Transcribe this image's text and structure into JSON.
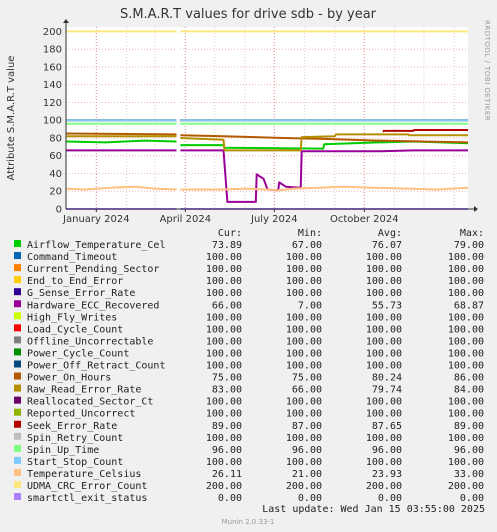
{
  "chart_data": {
    "type": "line",
    "title": "S.M.A.R.T values for drive sdb - by year",
    "ylabel": "Attribute S.M.A.R.T value",
    "ylim": [
      0,
      205
    ],
    "yticks": [
      0,
      20,
      40,
      60,
      80,
      100,
      120,
      140,
      160,
      180,
      200
    ],
    "xlim": [
      "2023-12-01",
      "2025-01-15"
    ],
    "xticks": [
      {
        "label": "January 2024",
        "date": "2024-01-01"
      },
      {
        "label": "April 2024",
        "date": "2024-04-01"
      },
      {
        "label": "July 2024",
        "date": "2024-07-01"
      },
      {
        "label": "October 2024",
        "date": "2024-10-01"
      }
    ],
    "gap": [
      "2024-03-23",
      "2024-03-27"
    ],
    "grid": true,
    "watermark": "RRDTOOL / TOBI OETIKER",
    "columns": [
      "Cur:",
      "Min:",
      "Avg:",
      "Max:"
    ],
    "series": [
      {
        "name": "Airflow_Temperature_Cel",
        "color": "#00cc00",
        "stats": [
          "73.89",
          "67.00",
          "76.07",
          "79.00"
        ],
        "points": [
          [
            "2023-12-01",
            76
          ],
          [
            "2024-01-10",
            75
          ],
          [
            "2024-02-20",
            77
          ],
          [
            "2024-03-23",
            76
          ],
          [
            "2024-03-27",
            72
          ],
          [
            "2024-05-10",
            72
          ],
          [
            "2024-05-11",
            69
          ],
          [
            "2024-08-20",
            68
          ],
          [
            "2024-08-21",
            73
          ],
          [
            "2024-10-15",
            75
          ],
          [
            "2024-11-20",
            76
          ],
          [
            "2025-01-15",
            74
          ]
        ]
      },
      {
        "name": "Command_Timeout",
        "color": "#0066b3",
        "stats": [
          "100.00",
          "100.00",
          "100.00",
          "100.00"
        ],
        "points": [
          [
            "2023-12-01",
            100
          ],
          [
            "2025-01-15",
            100
          ]
        ]
      },
      {
        "name": "Current_Pending_Sector",
        "color": "#ff8000",
        "stats": [
          "100.00",
          "100.00",
          "100.00",
          "100.00"
        ],
        "points": [
          [
            "2023-12-01",
            100
          ],
          [
            "2025-01-15",
            100
          ]
        ]
      },
      {
        "name": "End_to_End_Error",
        "color": "#ffcc00",
        "stats": [
          "100.00",
          "100.00",
          "100.00",
          "100.00"
        ],
        "points": [
          [
            "2023-12-01",
            100
          ],
          [
            "2025-01-15",
            100
          ]
        ]
      },
      {
        "name": "G_Sense_Error_Rate",
        "color": "#330099",
        "stats": [
          "100.00",
          "100.00",
          "100.00",
          "100.00"
        ],
        "points": [
          [
            "2023-12-01",
            100
          ],
          [
            "2025-01-15",
            100
          ]
        ]
      },
      {
        "name": "Hardware_ECC_Recovered",
        "color": "#990099",
        "stats": [
          "66.00",
          "7.00",
          "55.73",
          "68.87"
        ],
        "points": [
          [
            "2023-12-01",
            66
          ],
          [
            "2024-03-23",
            66
          ],
          [
            "2024-03-27",
            66
          ],
          [
            "2024-05-10",
            66
          ],
          [
            "2024-05-14",
            8
          ],
          [
            "2024-06-12",
            8
          ],
          [
            "2024-06-13",
            39
          ],
          [
            "2024-06-20",
            34
          ],
          [
            "2024-06-24",
            22
          ],
          [
            "2024-07-05",
            21
          ],
          [
            "2024-07-06",
            30
          ],
          [
            "2024-07-13",
            25
          ],
          [
            "2024-07-28",
            24
          ],
          [
            "2024-07-29",
            65
          ],
          [
            "2024-10-15",
            65
          ],
          [
            "2024-11-20",
            66
          ],
          [
            "2025-01-15",
            66
          ]
        ]
      },
      {
        "name": "High_Fly_Writes",
        "color": "#ccff00",
        "stats": [
          "100.00",
          "100.00",
          "100.00",
          "100.00"
        ],
        "points": [
          [
            "2023-12-01",
            100
          ],
          [
            "2025-01-15",
            100
          ]
        ]
      },
      {
        "name": "Load_Cycle_Count",
        "color": "#ff0000",
        "stats": [
          "100.00",
          "100.00",
          "100.00",
          "100.00"
        ],
        "points": [
          [
            "2023-12-01",
            100
          ],
          [
            "2025-01-15",
            100
          ]
        ]
      },
      {
        "name": "Offline_Uncorrectable",
        "color": "#808080",
        "stats": [
          "100.00",
          "100.00",
          "100.00",
          "100.00"
        ],
        "points": [
          [
            "2023-12-01",
            100
          ],
          [
            "2025-01-15",
            100
          ]
        ]
      },
      {
        "name": "Power_Cycle_Count",
        "color": "#008f00",
        "stats": [
          "100.00",
          "100.00",
          "100.00",
          "100.00"
        ],
        "points": [
          [
            "2023-12-01",
            100
          ],
          [
            "2025-01-15",
            100
          ]
        ]
      },
      {
        "name": "Power_Off_Retract_Count",
        "color": "#00487d",
        "stats": [
          "100.00",
          "100.00",
          "100.00",
          "100.00"
        ],
        "points": [
          [
            "2023-12-01",
            100
          ],
          [
            "2025-01-15",
            100
          ]
        ]
      },
      {
        "name": "Power_On_Hours",
        "color": "#b35a00",
        "stats": [
          "75.00",
          "75.00",
          "80.24",
          "86.00"
        ],
        "points": [
          [
            "2023-12-01",
            85
          ],
          [
            "2024-03-23",
            84
          ],
          [
            "2024-03-27",
            83
          ],
          [
            "2024-05-10",
            82
          ],
          [
            "2024-07-10",
            80
          ],
          [
            "2024-08-20",
            79
          ],
          [
            "2024-10-15",
            77
          ],
          [
            "2024-12-01",
            76
          ],
          [
            "2025-01-15",
            75
          ]
        ]
      },
      {
        "name": "Raw_Read_Error_Rate",
        "color": "#b38f00",
        "stats": [
          "83.00",
          "66.00",
          "79.74",
          "84.00"
        ],
        "points": [
          [
            "2023-12-01",
            82
          ],
          [
            "2024-03-23",
            82
          ],
          [
            "2024-03-27",
            80
          ],
          [
            "2024-05-10",
            78
          ],
          [
            "2024-05-11",
            66
          ],
          [
            "2024-07-28",
            66
          ],
          [
            "2024-07-29",
            81
          ],
          [
            "2024-09-01",
            82
          ],
          [
            "2024-09-02",
            84
          ],
          [
            "2024-11-15",
            84
          ],
          [
            "2024-11-16",
            83
          ],
          [
            "2025-01-15",
            83
          ]
        ]
      },
      {
        "name": "Reallocated_Sector_Ct",
        "color": "#6b006b",
        "stats": [
          "100.00",
          "100.00",
          "100.00",
          "100.00"
        ],
        "points": [
          [
            "2023-12-01",
            100
          ],
          [
            "2025-01-15",
            100
          ]
        ]
      },
      {
        "name": "Reported_Uncorrect",
        "color": "#8fb300",
        "stats": [
          "100.00",
          "100.00",
          "100.00",
          "100.00"
        ],
        "points": [
          [
            "2023-12-01",
            100
          ],
          [
            "2025-01-15",
            100
          ]
        ]
      },
      {
        "name": "Seek_Error_Rate",
        "color": "#b30000",
        "stats": [
          "89.00",
          "87.00",
          "87.65",
          "89.00"
        ],
        "points": [
          [
            "2023-12-01",
            87
          ],
          [
            "2024-10-20",
            87
          ],
          [
            "2024-10-21",
            88
          ],
          [
            "2024-11-20",
            88
          ],
          [
            "2024-11-21",
            89
          ],
          [
            "2025-01-15",
            89
          ]
        ]
      },
      {
        "name": "Spin_Retry_Count",
        "color": "#bebebe",
        "stats": [
          "100.00",
          "100.00",
          "100.00",
          "100.00"
        ],
        "points": [
          [
            "2023-12-01",
            100
          ],
          [
            "2025-01-15",
            100
          ]
        ]
      },
      {
        "name": "Spin_Up_Time",
        "color": "#80ff80",
        "stats": [
          "96.00",
          "96.00",
          "96.00",
          "96.00"
        ],
        "points": [
          [
            "2023-12-01",
            96
          ],
          [
            "2025-01-15",
            96
          ]
        ]
      },
      {
        "name": "Start_Stop_Count",
        "color": "#80c9ff",
        "stats": [
          "100.00",
          "100.00",
          "100.00",
          "100.00"
        ],
        "points": [
          [
            "2023-12-01",
            100
          ],
          [
            "2025-01-15",
            100
          ]
        ]
      },
      {
        "name": "Temperature_Celsius",
        "color": "#ffc080",
        "stats": [
          "26.11",
          "21.00",
          "23.93",
          "33.00"
        ],
        "points": [
          [
            "2023-12-01",
            23
          ],
          [
            "2023-12-20",
            22
          ],
          [
            "2024-01-15",
            24
          ],
          [
            "2024-02-10",
            25
          ],
          [
            "2024-03-01",
            23
          ],
          [
            "2024-03-23",
            22
          ],
          [
            "2024-03-27",
            22
          ],
          [
            "2024-05-10",
            22
          ],
          [
            "2024-06-01",
            23
          ],
          [
            "2024-06-24",
            22
          ],
          [
            "2024-07-05",
            21
          ],
          [
            "2024-07-20",
            23
          ],
          [
            "2024-08-15",
            24
          ],
          [
            "2024-09-10",
            25
          ],
          [
            "2024-10-10",
            24
          ],
          [
            "2024-11-15",
            23
          ],
          [
            "2024-12-15",
            22
          ],
          [
            "2025-01-15",
            24
          ]
        ]
      },
      {
        "name": "UDMA_CRC_Error_Count",
        "color": "#ffe680",
        "stats": [
          "200.00",
          "200.00",
          "200.00",
          "200.00"
        ],
        "points": [
          [
            "2023-12-01",
            200
          ],
          [
            "2025-01-15",
            200
          ]
        ]
      },
      {
        "name": "smartctl_exit_status",
        "color": "#aa80ff",
        "stats": [
          "0.00",
          "0.00",
          "0.00",
          "0.00"
        ],
        "points": [
          [
            "2023-12-01",
            0
          ],
          [
            "2025-01-15",
            0
          ]
        ]
      }
    ],
    "footer": "Last update: Wed Jan 15 03:55:00 2025",
    "munin": "Munin 2.0.33-1"
  }
}
